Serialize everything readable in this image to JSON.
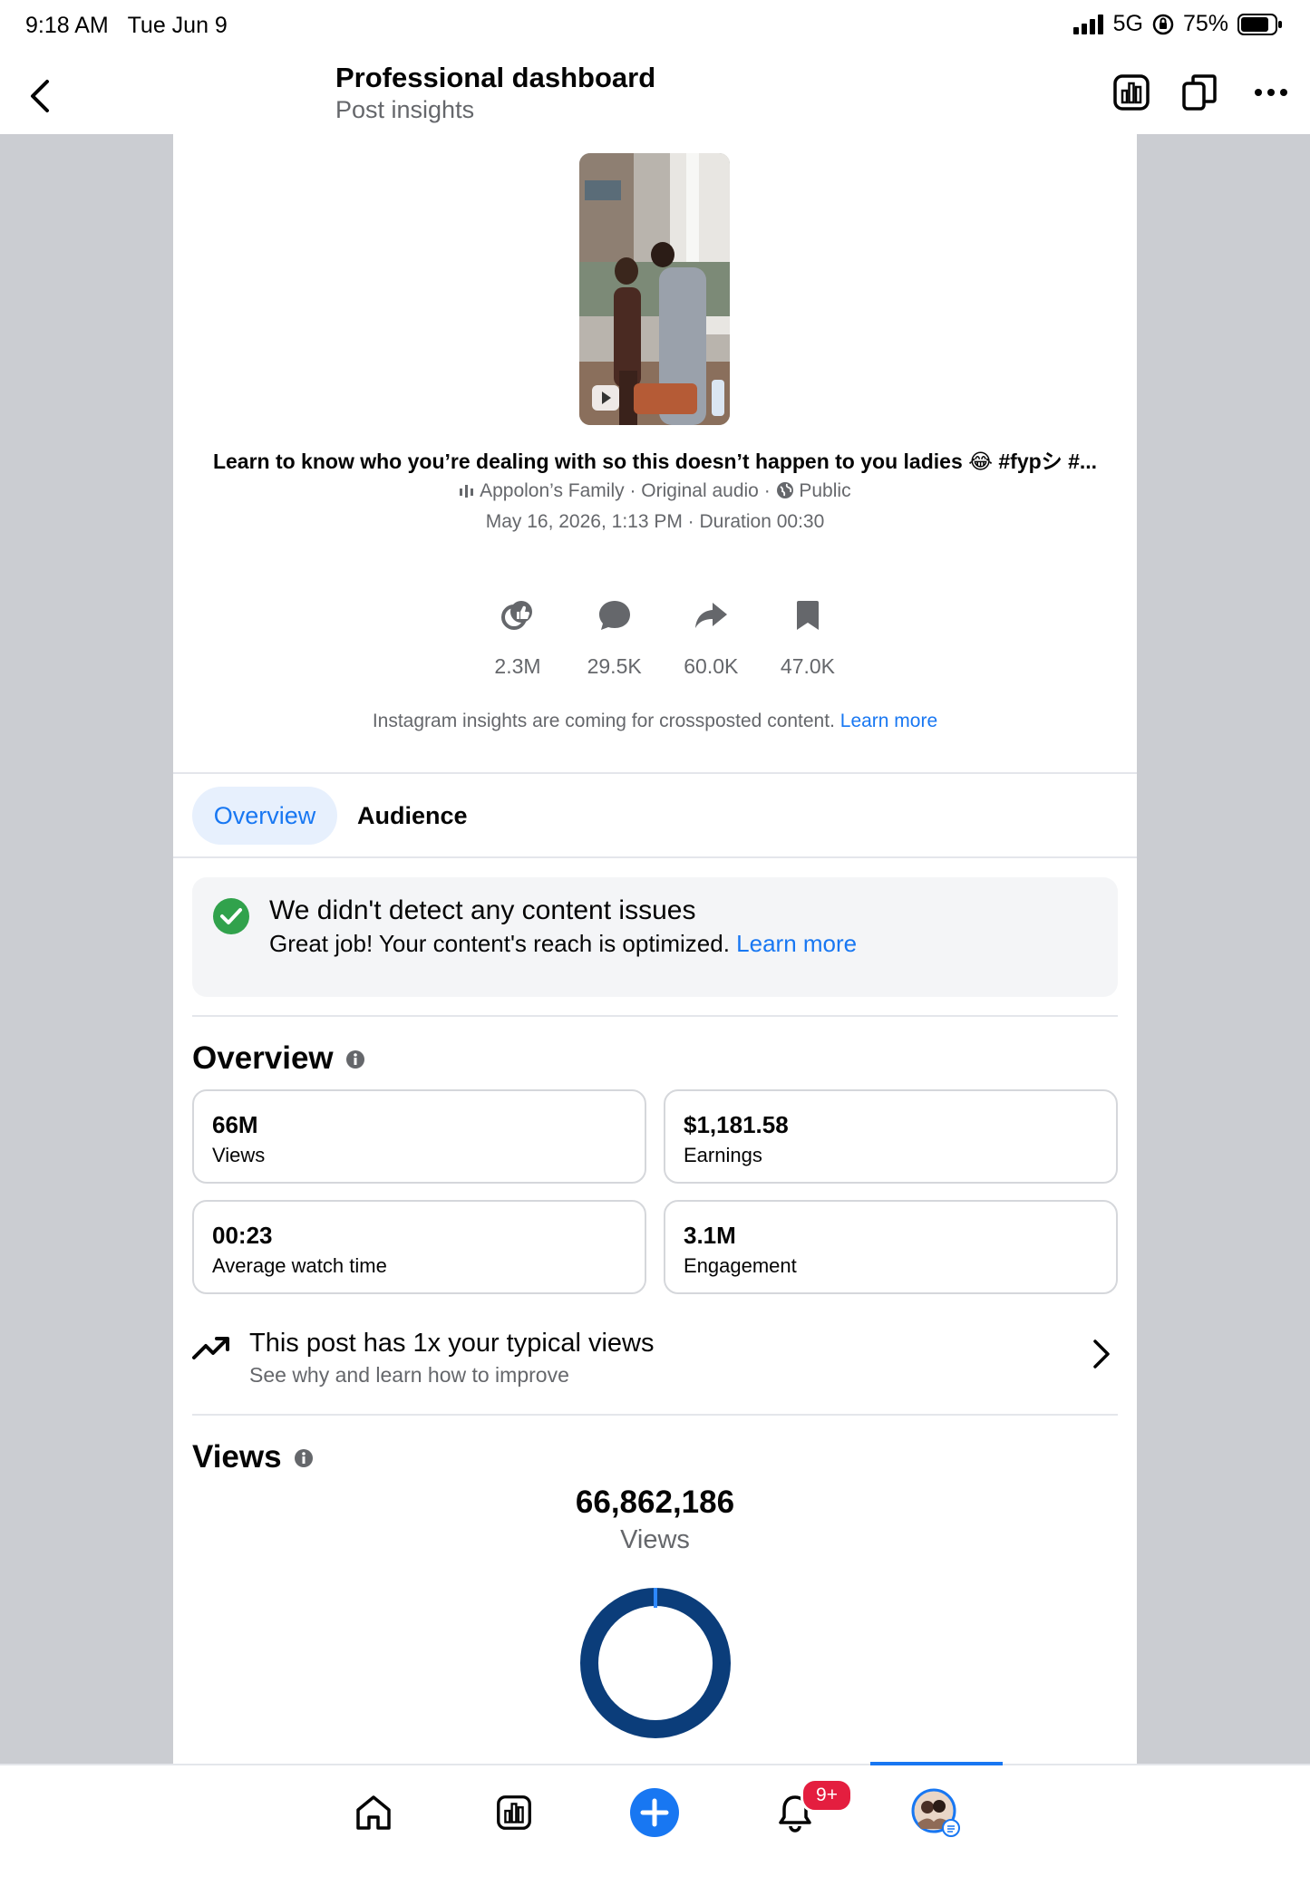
{
  "status_bar": {
    "time": "9:18 AM",
    "date": "Tue Jun 9",
    "network": "5G",
    "battery": "75%"
  },
  "header": {
    "title": "Professional dashboard",
    "subtitle": "Post insights"
  },
  "post": {
    "caption": "Learn to know who you’re dealing with so this doesn’t happen to you ladies 😂  #fypシ #...",
    "audio": "Appolon’s Family · Original audio ·",
    "privacy": "Public",
    "date_duration": "May 16, 2026, 1:13 PM · Duration 00:30",
    "stats": [
      {
        "icon": "reactions-icon",
        "value": "2.3M"
      },
      {
        "icon": "comment-icon",
        "value": "29.5K"
      },
      {
        "icon": "share-icon",
        "value": "60.0K"
      },
      {
        "icon": "save-icon",
        "value": "47.0K"
      }
    ],
    "ig_notice": "Instagram insights are coming for crossposted content.",
    "ig_learn_more": "Learn more"
  },
  "tabs": {
    "overview": "Overview",
    "audience": "Audience"
  },
  "content_check": {
    "title": "We didn't detect any content issues",
    "text": "Great job! Your content's reach is optimized.",
    "learn_more": "Learn more"
  },
  "overview": {
    "title": "Overview",
    "cards": [
      {
        "value": "66M",
        "label": "Views"
      },
      {
        "value": "$1,181.58",
        "label": "Earnings"
      },
      {
        "value": "00:23",
        "label": "Average watch time"
      },
      {
        "value": "3.1M",
        "label": "Engagement"
      }
    ]
  },
  "trend": {
    "title": "This post has 1x your typical views",
    "subtitle": "See why and learn how to improve"
  },
  "views": {
    "title": "Views",
    "total": "66,862,186",
    "label": "Views"
  },
  "colors": {
    "accent": "#1877f2",
    "donut": "#0b3d7a",
    "success": "#31a24c",
    "badge": "#e41e3f"
  },
  "bottom_nav": {
    "badge": "9+"
  }
}
